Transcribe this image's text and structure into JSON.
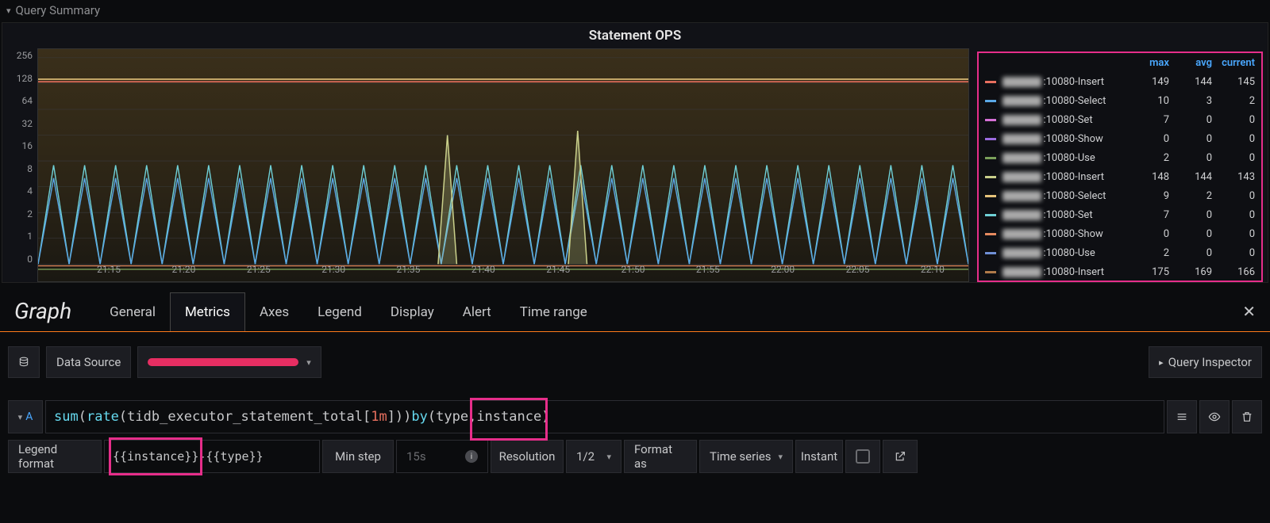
{
  "section_title": "Query Summary",
  "panel": {
    "title": "Statement OPS"
  },
  "chart_data": {
    "type": "line",
    "yscale": "log2",
    "yticks": [
      0,
      1,
      2,
      4,
      8,
      16,
      32,
      64,
      128,
      256
    ],
    "xticks": [
      "21:15",
      "21:20",
      "21:25",
      "21:30",
      "21:35",
      "21:40",
      "21:45",
      "21:50",
      "21:55",
      "22:00",
      "22:05",
      "22:10"
    ],
    "legend_columns": [
      "max",
      "avg",
      "current"
    ],
    "series": [
      {
        "name": ":10080-Insert",
        "color": "#e8705f",
        "max": 149,
        "avg": 144,
        "current": 145
      },
      {
        "name": ":10080-Select",
        "color": "#5aa8e6",
        "max": 10,
        "avg": 3,
        "current": 2
      },
      {
        "name": ":10080-Set",
        "color": "#d670d6",
        "max": 7,
        "avg": 0,
        "current": 0
      },
      {
        "name": ":10080-Show",
        "color": "#9b6bdf",
        "max": 0,
        "avg": 0,
        "current": 0
      },
      {
        "name": ":10080-Use",
        "color": "#7aa05a",
        "max": 2,
        "avg": 0,
        "current": 0
      },
      {
        "name": ":10080-Insert",
        "color": "#c9cf8a",
        "max": 148,
        "avg": 144,
        "current": 143
      },
      {
        "name": ":10080-Select",
        "color": "#e6c37a",
        "max": 9,
        "avg": 2,
        "current": 0
      },
      {
        "name": ":10080-Set",
        "color": "#6fd0d6",
        "max": 7,
        "avg": 0,
        "current": 0
      },
      {
        "name": ":10080-Show",
        "color": "#e68a5f",
        "max": 0,
        "avg": 0,
        "current": 0
      },
      {
        "name": ":10080-Use",
        "color": "#6f8fd6",
        "max": 2,
        "avg": 0,
        "current": 0
      },
      {
        "name": ":10080-Insert",
        "color": "#b07a4a",
        "max": 175,
        "avg": 169,
        "current": 166
      }
    ]
  },
  "editor": {
    "title": "Graph",
    "tabs": [
      "General",
      "Metrics",
      "Axes",
      "Legend",
      "Display",
      "Alert",
      "Time range"
    ],
    "active_tab": "Metrics"
  },
  "datasource": {
    "label": "Data Source",
    "query_inspector": "Query Inspector"
  },
  "query": {
    "id": "A",
    "expr_prefix": "sum",
    "expr_open": "(",
    "expr_rate": "rate",
    "expr_metric": "(tidb_executor_statement_total[",
    "expr_dur": "1m",
    "expr_after": "])) ",
    "expr_by": "by",
    "expr_group": " (type,",
    "expr_instance": "instance",
    "expr_close": ")"
  },
  "options": {
    "legend_format_label": "Legend format",
    "legend_format_value": "{{instance}}-{{type}}",
    "legend_format_highlight": "{{instance}}",
    "min_step_label": "Min step",
    "min_step_placeholder": "15s",
    "resolution_label": "Resolution",
    "resolution_value": "1/2",
    "format_as_label": "Format as",
    "format_as_value": "Time series",
    "instant_label": "Instant"
  }
}
